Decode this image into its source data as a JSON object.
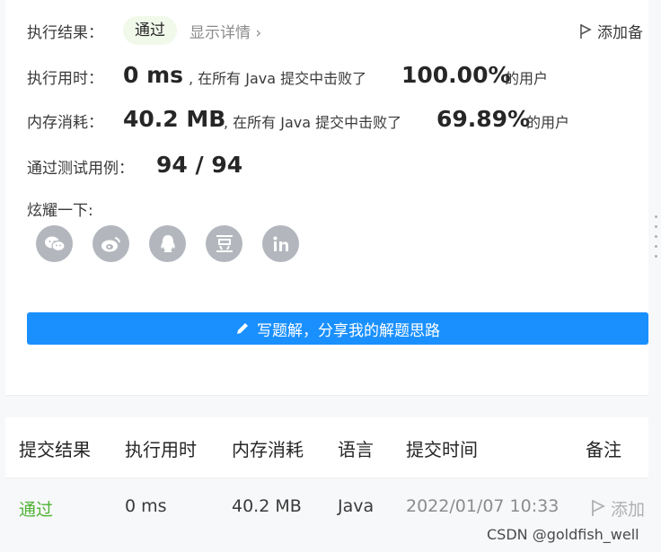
{
  "result": {
    "label": "执行结果：",
    "status": "通过",
    "detail_link": "显示详情",
    "add_note": "添加备"
  },
  "runtime": {
    "label": "执行用时：",
    "value": "0 ms",
    "text": ", 在所有 Java 提交中击败了",
    "percent": "100.00%",
    "suffix": "的用户"
  },
  "memory": {
    "label": "内存消耗：",
    "value": "40.2 MB",
    "text": ", 在所有 Java 提交中击败了",
    "percent": "69.89%",
    "suffix": "的用户"
  },
  "tests": {
    "label": "通过测试用例：",
    "value": "94 / 94"
  },
  "share": {
    "label": "炫耀一下:",
    "icons": [
      "wechat-icon",
      "weibo-icon",
      "qq-icon",
      "douban-icon",
      "linkedin-icon"
    ]
  },
  "write_button": "写题解，分享我的解题思路",
  "table": {
    "headers": [
      "提交结果",
      "执行用时",
      "内存消耗",
      "语言",
      "提交时间",
      "备注"
    ],
    "row": {
      "status": "通过",
      "runtime": "0 ms",
      "memory": "40.2 MB",
      "language": "Java",
      "time": "2022/01/07 10:33",
      "note": "添加"
    }
  },
  "watermark": "CSDN @goldfish_well",
  "colors": {
    "primary": "#1a90ff",
    "success": "#4fb233",
    "muted": "#8c8c8c",
    "icon_bg": "#b3b7bd"
  }
}
